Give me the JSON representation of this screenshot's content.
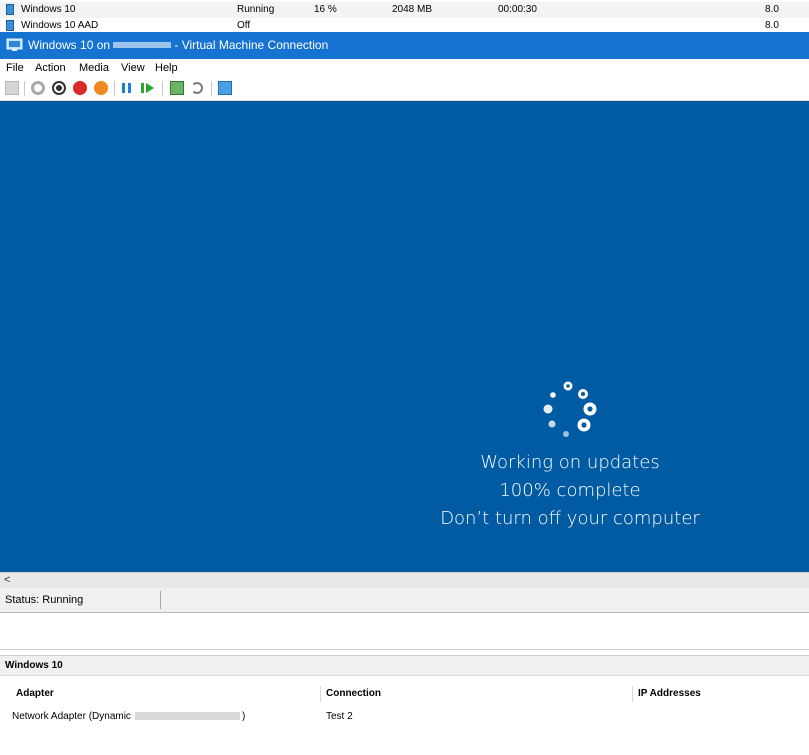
{
  "vm_list": {
    "rows": [
      {
        "name": "Windows 10",
        "state": "Running",
        "cpu": "16 %",
        "memory": "2048 MB",
        "uptime": "00:00:30",
        "version": "8.0"
      },
      {
        "name": "Windows 10 AAD",
        "state": "Off",
        "cpu": "",
        "memory": "",
        "uptime": "",
        "version": "8.0"
      }
    ]
  },
  "window": {
    "title_prefix": "Windows 10 on",
    "title_suffix": "- Virtual Machine Connection",
    "title_bar_color": "#1673d1"
  },
  "menu": [
    "File",
    "Action",
    "Media",
    "View",
    "Help"
  ],
  "toolbar": {
    "buttons": [
      "ctrl-alt-del-icon",
      "start-icon",
      "turn-off-icon",
      "shut-down-icon",
      "power-icon",
      "pause-icon",
      "resume-icon",
      "checkpoint-icon",
      "revert-icon",
      "enhanced-session-icon"
    ]
  },
  "screen": {
    "background": "#005ba3",
    "line1": "Working on updates",
    "line2": "100% complete",
    "line3": "Don’t turn off your computer"
  },
  "scrollbar": {
    "left_arrow": "<"
  },
  "status": {
    "text": "Status: Running"
  },
  "details": {
    "title": "Windows 10",
    "columns": [
      "Adapter",
      "Connection",
      "IP Addresses"
    ],
    "rows": [
      {
        "adapter_prefix": "Network Adapter (Dynamic",
        "adapter_suffix": ")",
        "connection": "Test 2",
        "ip": ""
      }
    ]
  }
}
